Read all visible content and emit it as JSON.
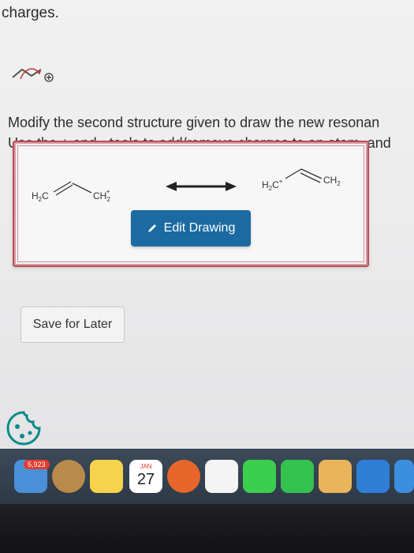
{
  "page": {
    "top_text": "charges.",
    "instructions_line1": "Modify the second structure given to draw the new resonan",
    "instructions_line2": "Use the + and - tools to add/remove charges to an atom, and"
  },
  "structures": {
    "left": {
      "h2c": "H",
      "h2c_sub": "2",
      "h2c_tail": "C",
      "ch2": "CH",
      "ch2_sub": "2",
      "ch2_charge": "+"
    },
    "right": {
      "h2c": "H",
      "h2c_sub": "2",
      "h2c_tail": "C",
      "h2c_charge": "+",
      "ch2": "CH",
      "ch2_sub": "2"
    }
  },
  "buttons": {
    "edit_drawing": "Edit Drawing",
    "save_for_later": "Save for Later"
  },
  "dock": {
    "mail_badge": "5,923",
    "calendar_month": "JAN",
    "calendar_day": "27"
  },
  "colors": {
    "edit_button": "#1b6aa1",
    "frame_border": "#b8505a"
  }
}
